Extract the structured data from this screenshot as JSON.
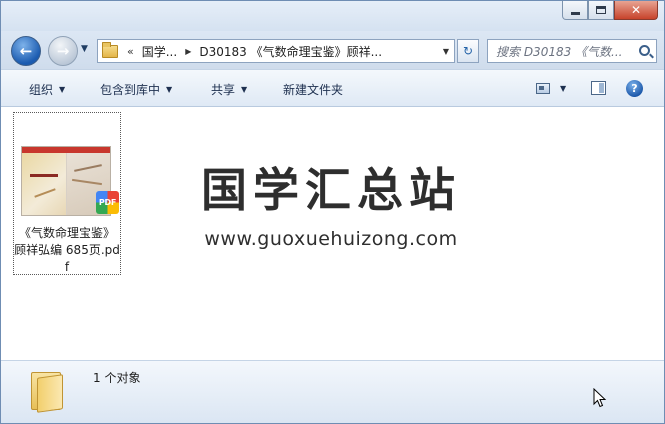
{
  "window": {
    "caption_buttons": {
      "minimize": "—",
      "maximize": "□",
      "close": "✕"
    }
  },
  "nav": {
    "back_glyph": "←",
    "forward_glyph": "→",
    "address": {
      "overflow": "«",
      "segments": [
        "国学...",
        "D30183 《气数命理宝鉴》顾祥..."
      ]
    },
    "refresh_glyph": "↻",
    "search_placeholder": "搜索 D30183 《气数..."
  },
  "toolbar": {
    "organize": "组织",
    "include_in_library": "包含到库中",
    "share": "共享",
    "new_folder": "新建文件夹",
    "help": "?"
  },
  "files": [
    {
      "name": "《气数命理宝鉴》顾祥弘编 685页.pdf",
      "badge": "PDF",
      "selected": true
    }
  ],
  "watermark": {
    "title": "国学汇总站",
    "url": "www.guoxuehuizong.com"
  },
  "status": {
    "count_text": "1 个对象"
  },
  "colors": {
    "accent": "#1b5bb0",
    "window_border": "#6f8db3",
    "close_button": "#c7432b"
  }
}
